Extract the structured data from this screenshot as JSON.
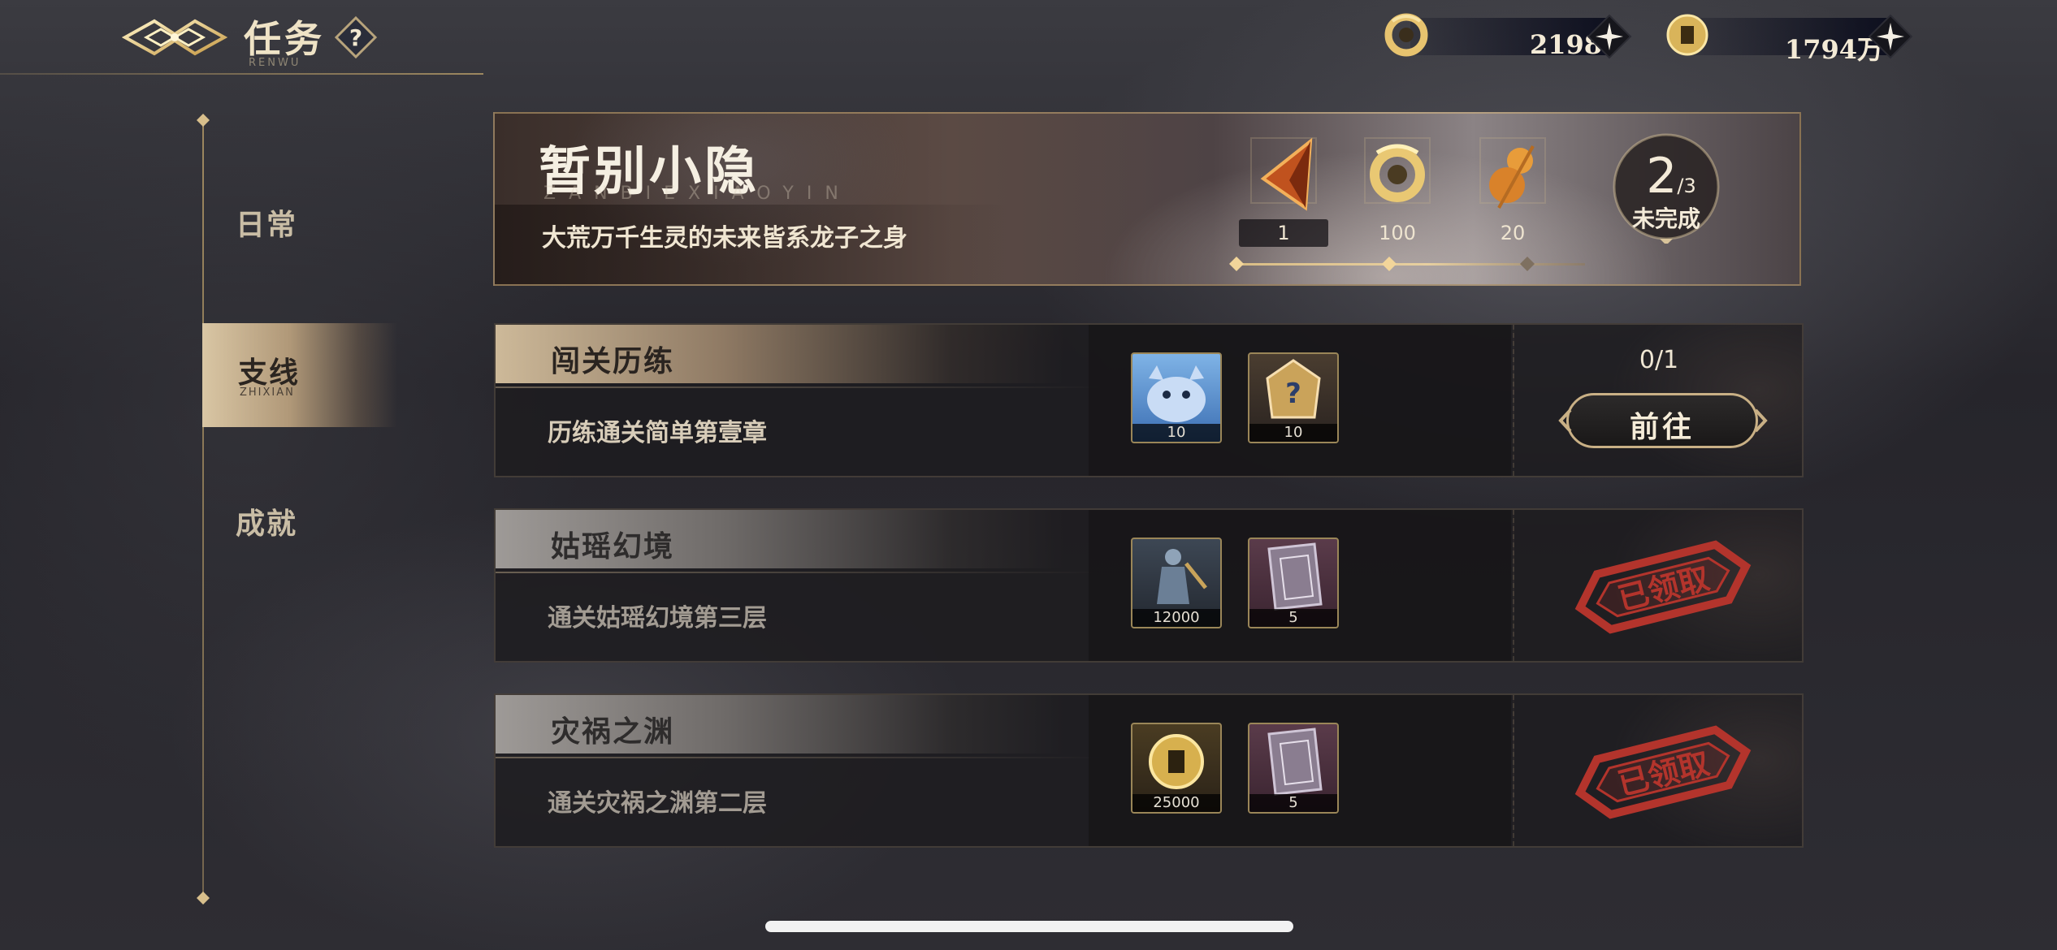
{
  "header": {
    "title": "任务",
    "subtitle": "RENWU",
    "help_icon": "question-mark-icon"
  },
  "currencies": [
    {
      "name": "jade-dragon",
      "icon": "dragon-jade-icon",
      "value": "2198"
    },
    {
      "name": "copper-coin",
      "icon": "coin-icon",
      "value": "1794万"
    }
  ],
  "nav": {
    "items": [
      {
        "label": "日常"
      },
      {
        "label": "支线",
        "sub": "ZHIXIAN",
        "active": true
      },
      {
        "label": "成就"
      }
    ]
  },
  "banner": {
    "title": "暂别小隐",
    "pinyin": "ZANBIEXIAOYIN",
    "description": "大荒万千生灵的未来皆系龙子之身",
    "rewards": [
      {
        "icon": "fire-crystal-icon",
        "count": "1"
      },
      {
        "icon": "dragon-jade-icon",
        "count": "100"
      },
      {
        "icon": "gourd-icon",
        "count": "20"
      }
    ],
    "progress": {
      "done": "2",
      "total": "/3",
      "status": "未完成",
      "fraction": 0.667
    }
  },
  "tasks": [
    {
      "name": "闯关历练",
      "description": "历练通关简单第壹章",
      "state": "active",
      "progress": "0/1",
      "button_label": "前往",
      "rewards": [
        {
          "icon": "blue-spirit-icon",
          "count": "10"
        },
        {
          "icon": "mystery-chest-icon",
          "count": "10"
        }
      ]
    },
    {
      "name": "姑瑶幻境",
      "description": "通关姑瑶幻境第三层",
      "state": "claimed",
      "stamp_label": "已领取",
      "rewards": [
        {
          "icon": "warrior-figure-icon",
          "count": "12000"
        },
        {
          "icon": "scroll-ticket-icon",
          "count": "5"
        }
      ]
    },
    {
      "name": "灾祸之渊",
      "description": "通关灾祸之渊第二层",
      "state": "claimed",
      "stamp_label": "已领取",
      "rewards": [
        {
          "icon": "coin-icon",
          "count": "25000"
        },
        {
          "icon": "scroll-ticket-icon",
          "count": "5"
        }
      ]
    }
  ],
  "colors": {
    "gold": "#c9b085",
    "stamp_red": "#b3342c",
    "text_light": "#efe3c6"
  }
}
